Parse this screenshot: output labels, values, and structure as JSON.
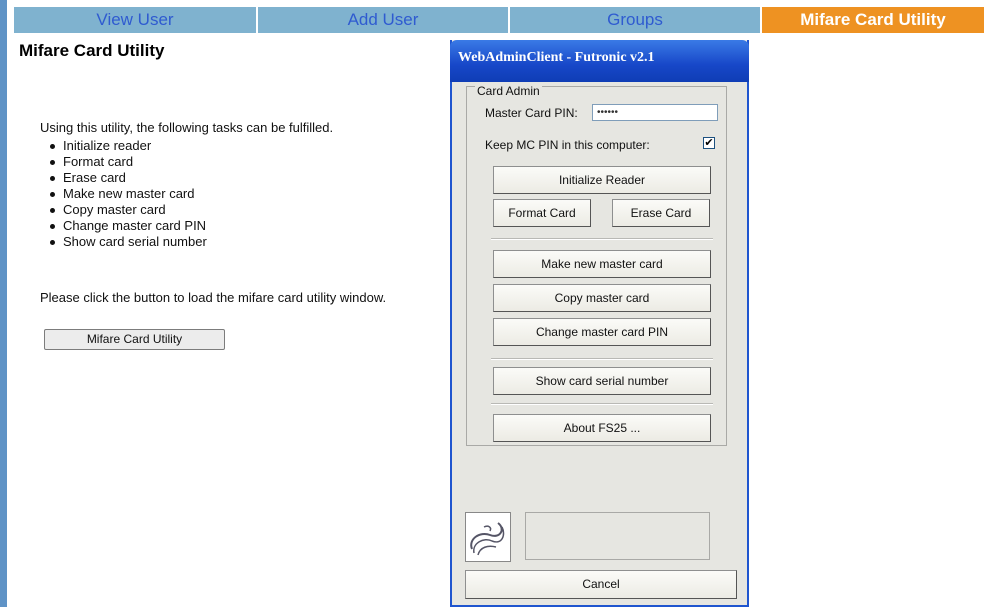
{
  "tabs": [
    {
      "label": "View User",
      "active": false
    },
    {
      "label": "Add User",
      "active": false
    },
    {
      "label": "Groups",
      "active": false
    },
    {
      "label": "Mifare Card Utility",
      "active": true
    }
  ],
  "page": {
    "title": "Mifare Card Utility",
    "intro": "Using this utility, the following tasks can be fulfilled.",
    "tasks": [
      "Initialize reader",
      "Format card",
      "Erase card",
      "Make new master card",
      "Copy master card",
      "Change master card PIN",
      "Show card serial number"
    ],
    "click_text": "Please click the button to load the mifare card utility window.",
    "button_label": "Mifare Card Utility"
  },
  "dialog": {
    "title": "WebAdminClient - Futronic v2.1",
    "group_label": "Card Admin",
    "pin_label": "Master Card PIN:",
    "pin_value": "••••••",
    "keep_pin_label": "Keep MC PIN in this computer:",
    "keep_pin_checked": "✔",
    "buttons": {
      "initialize": "Initialize Reader",
      "format": "Format Card",
      "erase": "Erase Card",
      "make_master": "Make new master card",
      "copy_master": "Copy master card",
      "change_pin": "Change master card PIN",
      "show_serial": "Show card serial number",
      "about": "About FS25 ..."
    },
    "cancel": "Cancel"
  },
  "colors": {
    "tab_bg": "#7fb2cf",
    "tab_text": "#2f5bd0",
    "tab_active_bg": "#ee9222",
    "titlebar_blue": "#1747c8"
  }
}
